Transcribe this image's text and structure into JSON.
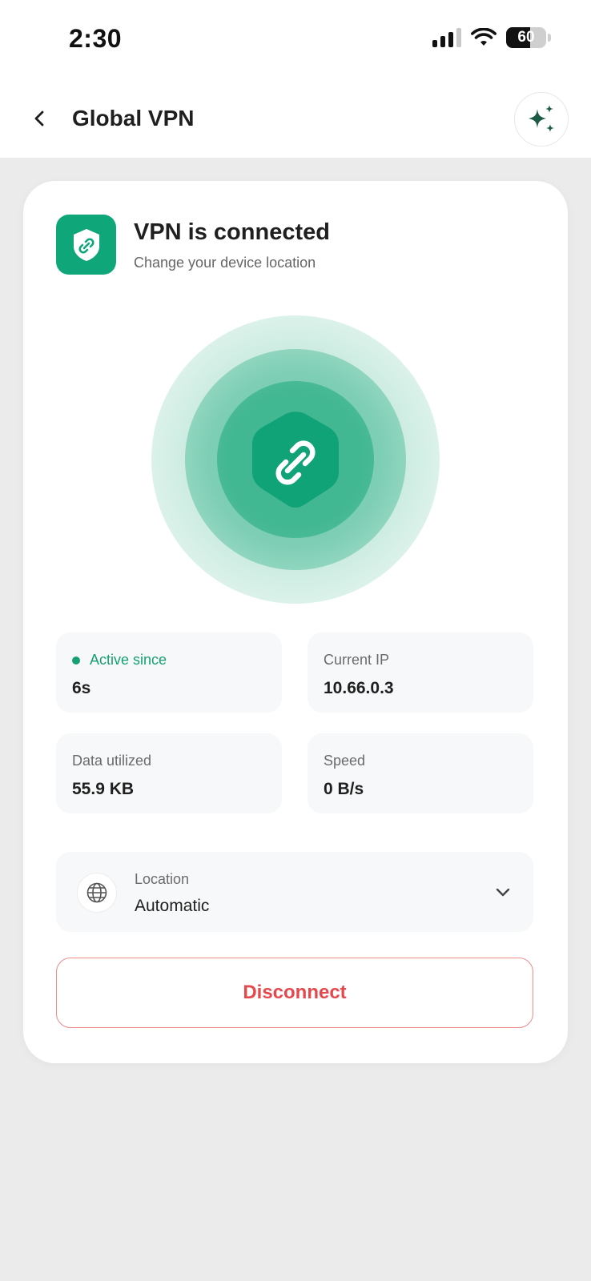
{
  "status_bar": {
    "time": "2:30",
    "battery": "60",
    "battery_level": 0.6,
    "signal_icon": "cellular-signal-icon",
    "wifi_icon": "wifi-icon"
  },
  "header": {
    "title": "Global VPN",
    "back_icon": "chevron-left-icon",
    "action_icon": "sparkle-icon"
  },
  "card": {
    "title": "VPN is connected",
    "subtitle": "Change your device location",
    "icon": "shield-link-icon"
  },
  "stats": [
    {
      "label": "Active since",
      "value": "6s",
      "status": "active"
    },
    {
      "label": "Current IP",
      "value": "10.66.0.3"
    },
    {
      "label": "Data utilized",
      "value": "55.9 KB"
    },
    {
      "label": "Speed",
      "value": "0 B/s"
    }
  ],
  "location": {
    "label": "Location",
    "value": "Automatic",
    "icon": "globe-icon"
  },
  "disconnect_label": "Disconnect",
  "colors": {
    "accent": "#0fa77a",
    "active": "#159f72",
    "danger": "#e5484d",
    "background": "#ebebeb"
  }
}
